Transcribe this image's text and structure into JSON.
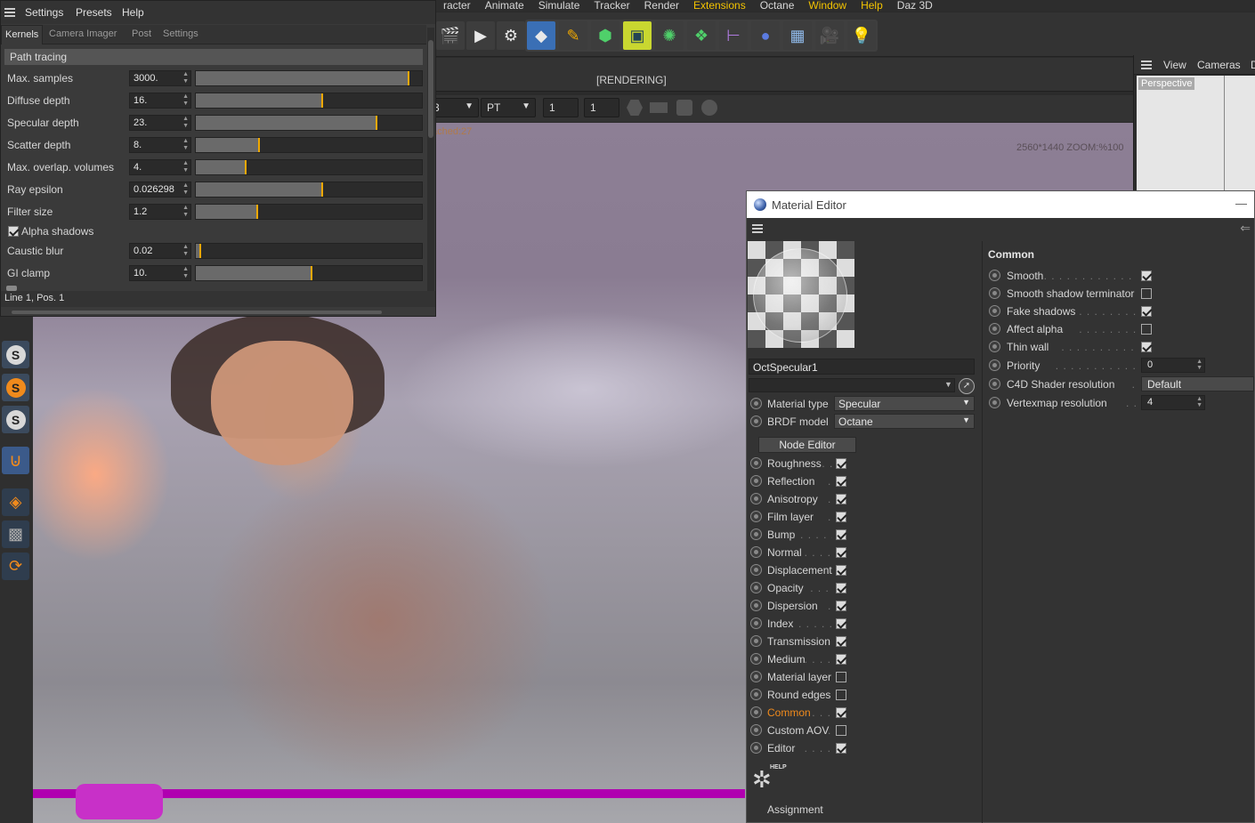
{
  "c4d_menu": [
    "racter",
    "Animate",
    "Simulate",
    "Tracker",
    "Render",
    "Extensions",
    "Octane",
    "Window",
    "Help",
    "Daz 3D"
  ],
  "viewport": {
    "status": "[RENDERING]",
    "cached_label": "ached:27",
    "resolution_info": "2560*1440 ZOOM:%100",
    "controls": {
      "field_left": "3",
      "mode": "PT",
      "val1": "1",
      "val2": "1"
    }
  },
  "view_panel": {
    "menu": [
      "View",
      "Cameras",
      "D"
    ],
    "camera": "Perspective"
  },
  "octane_settings": {
    "menu": [
      "Settings",
      "Presets",
      "Help"
    ],
    "tabs": [
      "Kernels",
      "Camera Imager",
      "Post",
      "Settings"
    ],
    "section": "Path tracing",
    "rows": [
      {
        "label": "Max. samples",
        "value": "3000.",
        "slider": 0.94
      },
      {
        "label": "Diffuse depth",
        "value": "16.",
        "slider": 0.56
      },
      {
        "label": "Specular depth",
        "value": "23.",
        "slider": 0.8
      },
      {
        "label": "Scatter depth",
        "value": "8.",
        "slider": 0.28
      },
      {
        "label": "Max. overlap. volumes",
        "value": "4.",
        "slider": 0.22
      },
      {
        "label": "Ray epsilon",
        "value": "0.026298",
        "slider": 0.56
      },
      {
        "label": "Filter size",
        "value": "1.2",
        "slider": 0.27
      }
    ],
    "alpha_shadows": "Alpha shadows",
    "rows2": [
      {
        "label": "Caustic blur",
        "value": "0.02",
        "slider": 0.02
      },
      {
        "label": "GI clamp",
        "value": "10.",
        "slider": 0.51
      }
    ],
    "status": "Line 1, Pos. 1"
  },
  "material_editor": {
    "title": "Material Editor",
    "material_name": "OctSpecular1",
    "material_type_label": "Material type",
    "material_type": "Specular",
    "brdf_label": "BRDF model",
    "brdf": "Octane",
    "node_editor": "Node Editor",
    "channels": [
      {
        "label": "Roughness",
        "checked": true
      },
      {
        "label": "Reflection",
        "checked": true
      },
      {
        "label": "Anisotropy",
        "checked": true
      },
      {
        "label": "Film layer",
        "checked": true
      },
      {
        "label": "Bump",
        "checked": true
      },
      {
        "label": "Normal",
        "checked": true
      },
      {
        "label": "Displacement",
        "checked": true
      },
      {
        "label": "Opacity",
        "checked": true
      },
      {
        "label": "Dispersion",
        "checked": true
      },
      {
        "label": "Index",
        "checked": true
      },
      {
        "label": "Transmission",
        "checked": true
      },
      {
        "label": "Medium",
        "checked": true
      },
      {
        "label": "Material layer",
        "checked": false
      },
      {
        "label": "Round edges",
        "checked": false
      },
      {
        "label": "Common",
        "checked": true
      },
      {
        "label": "Custom AOV",
        "checked": false
      },
      {
        "label": "Editor",
        "checked": true
      }
    ],
    "help_label": "HELP",
    "assignment": "Assignment",
    "common": {
      "title": "Common",
      "rows": [
        {
          "label": "Smooth",
          "type": "check",
          "checked": true
        },
        {
          "label": "Smooth shadow terminator",
          "type": "check",
          "checked": false
        },
        {
          "label": "Fake shadows",
          "type": "check",
          "checked": true
        },
        {
          "label": "Affect alpha",
          "type": "check",
          "checked": false
        },
        {
          "label": "Thin wall",
          "type": "check",
          "checked": true
        },
        {
          "label": "Priority",
          "type": "number",
          "value": "0"
        },
        {
          "label": "C4D Shader resolution",
          "type": "select",
          "value": "Default"
        },
        {
          "label": "Vertexmap resolution",
          "type": "number",
          "value": "4"
        }
      ]
    }
  }
}
